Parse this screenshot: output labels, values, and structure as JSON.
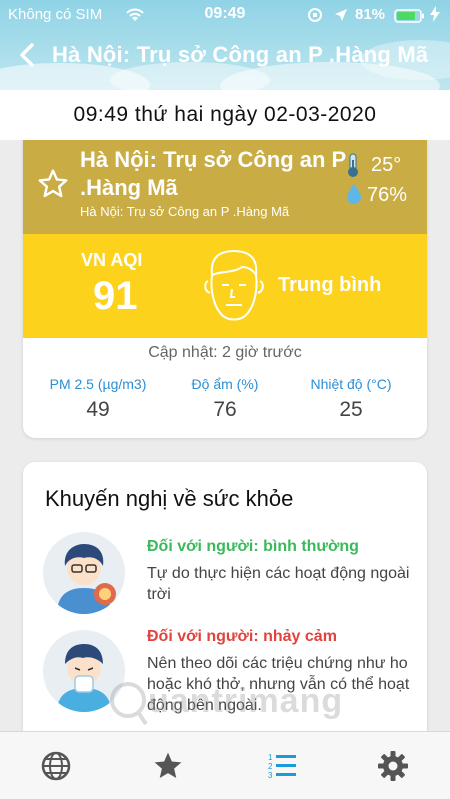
{
  "status_bar": {
    "carrier": "Không có SIM",
    "time": "09:49",
    "battery": "81%"
  },
  "nav": {
    "title": "Hà Nội: Trụ sở Công an P .Hàng Mã"
  },
  "date_line": "09:49 thứ hai ngày 02-03-2020",
  "location": {
    "name": "Hà Nội: Trụ sở Công an P .Hàng Mã",
    "subtitle": "Hà Nội: Trụ sở Công an P .Hàng Mã",
    "temperature": "25°",
    "humidity": "76%"
  },
  "aqi": {
    "label": "VN AQI",
    "value": "91",
    "level": "Trung bình"
  },
  "updated": "Cập nhật: 2 giờ trước",
  "metrics": [
    {
      "label": "PM 2.5 (µg/m3)",
      "value": "49"
    },
    {
      "label": "Độ ẩm (%)",
      "value": "76"
    },
    {
      "label": "Nhiệt độ (°C)",
      "value": "25"
    }
  ],
  "health": {
    "title": "Khuyến nghị về sức khỏe",
    "groups": [
      {
        "title": "Đối với người: bình thường",
        "text": "Tự do thực hiện các hoạt động ngoài trời",
        "color": "#3cb95c"
      },
      {
        "title": "Đối với người: nhảy cảm",
        "text": "Nên theo dõi các triệu chứng như ho hoặc khó thở, nhưng vẫn có thể hoạt động bên ngoài.",
        "color": "#e0443e"
      }
    ]
  },
  "watermark": "uantrimang",
  "tabs": [
    {
      "icon": "globe-icon"
    },
    {
      "icon": "star-icon"
    },
    {
      "icon": "ranking-list-icon",
      "active": true
    },
    {
      "icon": "gear-icon"
    }
  ],
  "colors": {
    "location_band": "#c9ac44",
    "aqi_band": "#fdd21c",
    "accent_blue": "#2a8fd6",
    "active_tab": "#1a9bd8"
  }
}
